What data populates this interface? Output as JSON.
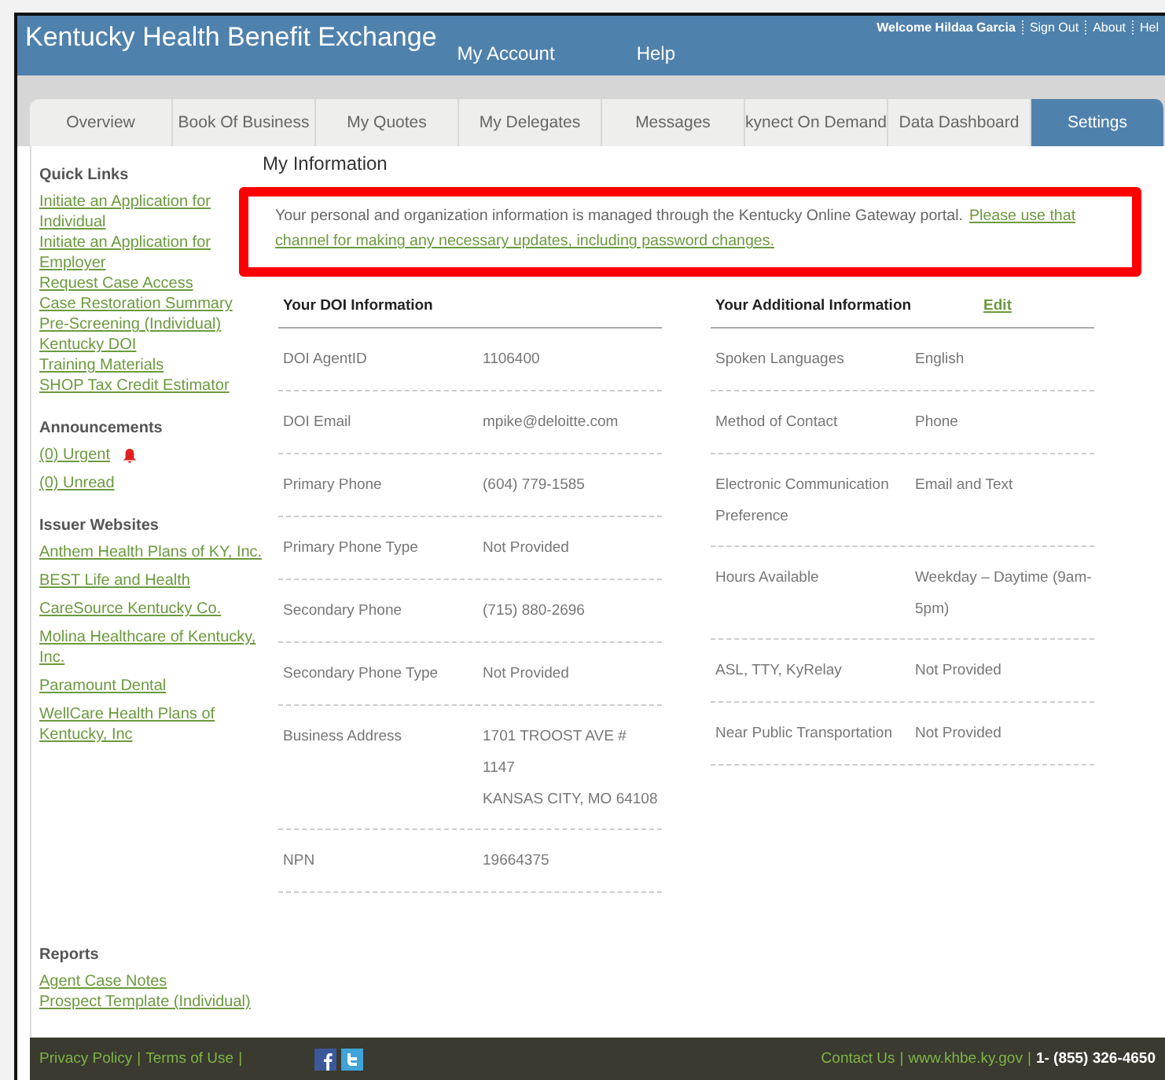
{
  "header": {
    "title": "Kentucky Health Benefit Exchange",
    "nav": [
      "My Account",
      "Help"
    ],
    "user_links": [
      "Welcome Hildaa Garcia",
      "Sign Out",
      "About",
      "Hel"
    ]
  },
  "tabs": [
    {
      "label": "Overview",
      "selected": false
    },
    {
      "label": "Book Of Business",
      "selected": false
    },
    {
      "label": "My Quotes",
      "selected": false
    },
    {
      "label": "My Delegates",
      "selected": false
    },
    {
      "label": "Messages",
      "selected": false
    },
    {
      "label": "kynect On Demand",
      "selected": false
    },
    {
      "label": "Data Dashboard",
      "selected": false
    },
    {
      "label": "Settings",
      "selected": true
    }
  ],
  "sidebar": [
    {
      "heading": "Quick Links",
      "links": [
        {
          "label": "Initiate an Application for Individual",
          "kind": "link"
        },
        {
          "label": "Initiate an Application for Employer",
          "kind": "link"
        },
        {
          "label": "Request Case Access",
          "kind": "link"
        },
        {
          "label": "Case Restoration Summary",
          "kind": "link"
        },
        {
          "label": "Pre-Screening (Individual)",
          "kind": "link"
        },
        {
          "label": "Kentucky DOI",
          "kind": "link"
        },
        {
          "label": "Training Materials",
          "kind": "link"
        },
        {
          "label": "SHOP Tax Credit Estimator",
          "kind": "link"
        }
      ]
    },
    {
      "heading": "Announcements",
      "links": [
        {
          "label": "(0) Urgent",
          "kind": "alert"
        },
        {
          "label": "(0) Unread",
          "kind": "link"
        }
      ]
    },
    {
      "heading": "Issuer Websites",
      "links": [
        {
          "label": "Anthem Health Plans of KY, Inc.",
          "kind": "link"
        },
        {
          "label": "BEST Life and Health",
          "kind": "link"
        },
        {
          "label": "CareSource Kentucky Co.",
          "kind": "link"
        },
        {
          "label": "Molina Healthcare of Kentucky, Inc.",
          "kind": "link"
        },
        {
          "label": "Paramount Dental",
          "kind": "link"
        },
        {
          "label": "WellCare Health Plans of Kentucky, Inc",
          "kind": "link"
        }
      ]
    },
    {
      "heading": "Reports",
      "links": [
        {
          "label": "Agent Case Notes",
          "kind": "link"
        },
        {
          "label": "Prospect Template (Individual)",
          "kind": "link"
        }
      ]
    }
  ],
  "main": {
    "title": "My Information",
    "notice": {
      "text": "Your personal and organization information is managed through the Kentucky Online Gateway portal.",
      "link": [
        "Please use that",
        "channel for making any necessary updates, including password changes."
      ]
    },
    "panels": [
      {
        "heading": "Your DOI Information",
        "rows": [
          {
            "label": "DOI AgentID",
            "value": [
              "1106400"
            ]
          },
          {
            "label": "DOI Email",
            "value": [
              "mpike@deloitte.com"
            ]
          },
          {
            "label": "Primary Phone",
            "value": [
              "(604) 779-1585"
            ]
          },
          {
            "label": "Primary Phone Type",
            "value": [
              "Not Provided"
            ]
          },
          {
            "label": "Secondary Phone",
            "value": [
              "(715) 880-2696"
            ]
          },
          {
            "label": "Secondary Phone Type",
            "value": [
              "Not Provided"
            ]
          },
          {
            "label": "Business Address",
            "value": [
              "1701 TROOST AVE # 1147",
              "KANSAS CITY, MO 64108"
            ]
          },
          {
            "label": "NPN",
            "value": [
              "19664375"
            ]
          }
        ]
      },
      {
        "heading": "Your Additional Information",
        "action": "Edit",
        "rows": [
          {
            "label": "Spoken Languages",
            "value": [
              "English"
            ]
          },
          {
            "label": "Method of Contact",
            "value": [
              "Phone"
            ]
          },
          {
            "label": "Electronic Communication Preference",
            "value": [
              "Email and Text"
            ]
          },
          {
            "label": "Hours Available",
            "value": [
              "Weekday – Daytime (9am-5pm)"
            ]
          },
          {
            "label": "ASL, TTY, KyRelay",
            "value": [
              "Not Provided"
            ]
          },
          {
            "label": "Near Public Transportation",
            "value": [
              "Not Provided"
            ]
          }
        ]
      }
    ]
  },
  "footer": {
    "separator": "|",
    "left_links": [
      "Privacy Policy",
      "Terms of Use"
    ],
    "right_links": [
      "Contact Us",
      "www.khbe.ky.gov"
    ],
    "phone": "1- (855) 326-4650"
  }
}
